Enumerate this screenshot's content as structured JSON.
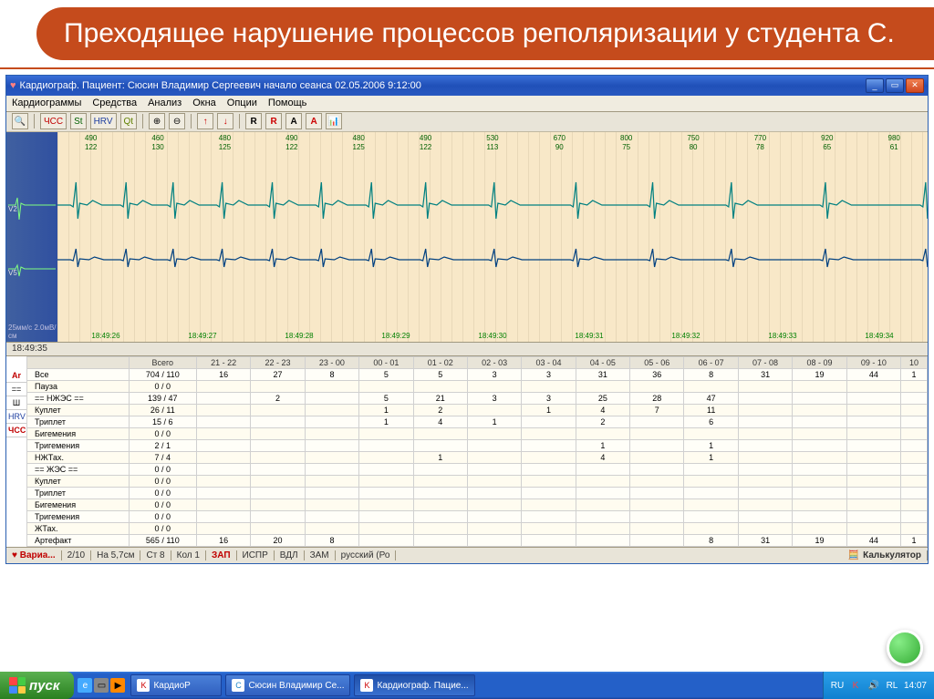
{
  "slide": {
    "title": "Преходящее нарушение процессов реполяризации у студента С."
  },
  "window": {
    "title": "Кардиограф. Пациент: Сюсин Владимир Сергеевич   начало сеанса 02.05.2006 9:12:00",
    "menus": [
      "Кардиограммы",
      "Средства",
      "Анализ",
      "Окна",
      "Опции",
      "Помощь"
    ],
    "toolbar_labels": {
      "chss": "ЧСС",
      "st": "St",
      "hrv": "HRV",
      "qt": "Qt",
      "r": "R",
      "a": "A"
    }
  },
  "ecg": {
    "lead_top": "V2",
    "lead_bottom": "V5",
    "scale": "25мм/с 2.0мВ/см",
    "current_time": "18:49:35",
    "top_pairs": [
      {
        "a": "490",
        "b": "122"
      },
      {
        "a": "460",
        "b": "130"
      },
      {
        "a": "480",
        "b": "125"
      },
      {
        "a": "490",
        "b": "122"
      },
      {
        "a": "480",
        "b": "125"
      },
      {
        "a": "490",
        "b": "122"
      },
      {
        "a": "530",
        "b": "113"
      },
      {
        "a": "670",
        "b": "90"
      },
      {
        "a": "800",
        "b": "75"
      },
      {
        "a": "750",
        "b": "80"
      },
      {
        "a": "770",
        "b": "78"
      },
      {
        "a": "920",
        "b": "65"
      },
      {
        "a": "980",
        "b": "61"
      }
    ],
    "times": [
      "18:49:26",
      "18:49:27",
      "18:49:28",
      "18:49:29",
      "18:49:30",
      "18:49:31",
      "18:49:32",
      "18:49:33",
      "18:49:34"
    ]
  },
  "table": {
    "side_tabs": [
      "Ar",
      "==",
      "Ш",
      "HRV",
      "ЧСС"
    ],
    "headers": [
      "",
      "Всего",
      "21 - 22",
      "22 - 23",
      "23 - 00",
      "00 - 01",
      "01 - 02",
      "02 - 03",
      "03 - 04",
      "04 - 05",
      "05 - 06",
      "06 - 07",
      "07 - 08",
      "08 - 09",
      "09 - 10",
      "10"
    ],
    "rows": [
      {
        "label": "Все",
        "cells": [
          "704 / 110",
          "16",
          "27",
          "8",
          "5",
          "5",
          "3",
          "3",
          "31",
          "36",
          "8",
          "31",
          "19",
          "44",
          "1"
        ]
      },
      {
        "label": "Пауза",
        "cells": [
          "0 / 0",
          "",
          "",
          "",
          "",
          "",
          "",
          "",
          "",
          "",
          "",
          "",
          "",
          "",
          ""
        ]
      },
      {
        "label": "== НЖЭС ==",
        "cells": [
          "139 / 47",
          "",
          "2",
          "",
          "5",
          "21",
          "3",
          "3",
          "25",
          "28",
          "47",
          "",
          "",
          "",
          ""
        ]
      },
      {
        "label": "Куплет",
        "cells": [
          "26 / 11",
          "",
          "",
          "",
          "1",
          "2",
          "",
          "1",
          "4",
          "7",
          "11",
          "",
          "",
          "",
          ""
        ]
      },
      {
        "label": "Триплет",
        "cells": [
          "15 / 6",
          "",
          "",
          "",
          "1",
          "4",
          "1",
          "",
          "2",
          "",
          "6",
          "",
          "",
          "",
          ""
        ]
      },
      {
        "label": "Бигемения",
        "cells": [
          "0 / 0",
          "",
          "",
          "",
          "",
          "",
          "",
          "",
          "",
          "",
          "",
          "",
          "",
          "",
          ""
        ]
      },
      {
        "label": "Тригемения",
        "cells": [
          "2 / 1",
          "",
          "",
          "",
          "",
          "",
          "",
          "",
          "1",
          "",
          "1",
          "",
          "",
          "",
          ""
        ]
      },
      {
        "label": "НЖТах.",
        "cells": [
          "7 / 4",
          "",
          "",
          "",
          "",
          "1",
          "",
          "",
          "4",
          "",
          "1",
          "",
          "",
          "",
          ""
        ]
      },
      {
        "label": "== ЖЭС ==",
        "cells": [
          "0 / 0",
          "",
          "",
          "",
          "",
          "",
          "",
          "",
          "",
          "",
          "",
          "",
          "",
          "",
          ""
        ]
      },
      {
        "label": "Куплет",
        "cells": [
          "0 / 0",
          "",
          "",
          "",
          "",
          "",
          "",
          "",
          "",
          "",
          "",
          "",
          "",
          "",
          ""
        ]
      },
      {
        "label": "Триплет",
        "cells": [
          "0 / 0",
          "",
          "",
          "",
          "",
          "",
          "",
          "",
          "",
          "",
          "",
          "",
          "",
          "",
          ""
        ]
      },
      {
        "label": "Бигемения",
        "cells": [
          "0 / 0",
          "",
          "",
          "",
          "",
          "",
          "",
          "",
          "",
          "",
          "",
          "",
          "",
          "",
          ""
        ]
      },
      {
        "label": "Тригемения",
        "cells": [
          "0 / 0",
          "",
          "",
          "",
          "",
          "",
          "",
          "",
          "",
          "",
          "",
          "",
          "",
          "",
          ""
        ]
      },
      {
        "label": "ЖТах.",
        "cells": [
          "0 / 0",
          "",
          "",
          "",
          "",
          "",
          "",
          "",
          "",
          "",
          "",
          "",
          "",
          "",
          ""
        ]
      },
      {
        "label": "Артефакт",
        "cells": [
          "565 / 110",
          "16",
          "20",
          "8",
          "",
          "",
          "",
          "",
          "",
          "",
          "8",
          "31",
          "19",
          "44",
          "1"
        ]
      }
    ]
  },
  "statusbar": {
    "varia": "Вариа...",
    "items": [
      "2/10",
      "На 5,7см",
      "Ст 8",
      "Кол 1",
      "ЗАП",
      "ИСПР",
      "ВДЛ",
      "ЗАМ",
      "русский (Ро"
    ],
    "calc": "Калькулятор"
  },
  "taskbar": {
    "start": "пуск",
    "items": [
      {
        "icon": "K",
        "label": "КардиоР",
        "color": "#c00"
      },
      {
        "icon": "С",
        "label": "Сюсин Владимир Се...",
        "color": "#28c"
      },
      {
        "icon": "K",
        "label": "Кардиограф. Пацие...",
        "color": "#c00"
      }
    ],
    "tray": {
      "lang": "RU",
      "rl": "RL",
      "time": "14:07"
    }
  }
}
